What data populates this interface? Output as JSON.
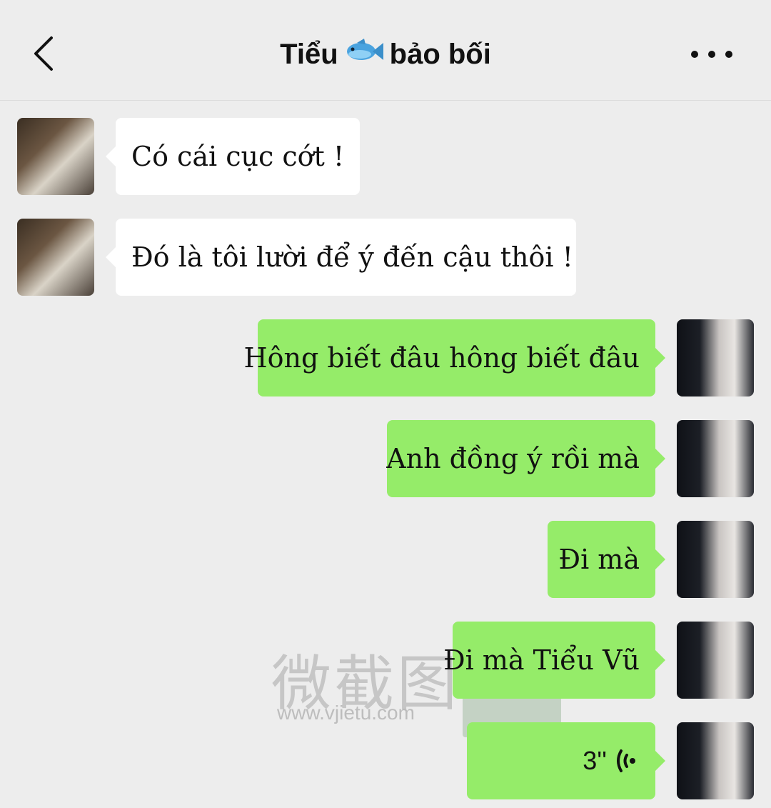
{
  "header": {
    "title_left": "Tiểu",
    "title_right": "bảo bối",
    "title_icon": "fish-emoji"
  },
  "watermark": {
    "main": "微截图",
    "url": "www.vjietu.com"
  },
  "messages": [
    {
      "side": "in",
      "text": "Có cái cục cớt !"
    },
    {
      "side": "in",
      "text": "Đó là tôi lười để ý đến cậu thôi !"
    },
    {
      "side": "out",
      "text": "Hông biết đâu hông biết đâu"
    },
    {
      "side": "out",
      "text": "Anh đồng ý rồi mà"
    },
    {
      "side": "out",
      "text": "Đi mà"
    },
    {
      "side": "out",
      "text": "Đi mà Tiểu Vũ"
    },
    {
      "side": "out",
      "type": "voice",
      "text": "3''",
      "icon": "voice-wave-icon"
    }
  ],
  "colors": {
    "background": "#ededed",
    "incoming_bubble": "#ffffff",
    "outgoing_bubble": "#95ec69"
  }
}
